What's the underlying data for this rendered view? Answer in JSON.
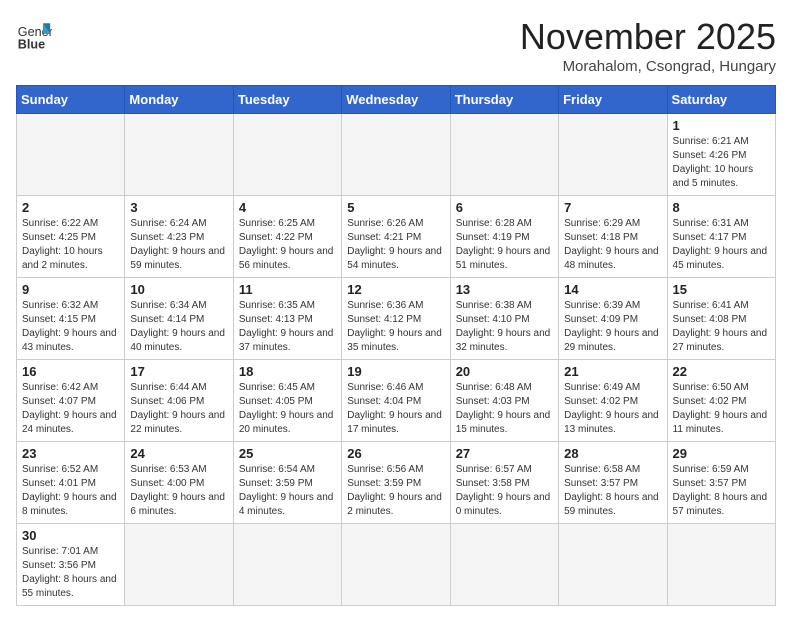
{
  "header": {
    "logo_text_normal": "General",
    "logo_text_bold": "Blue",
    "title": "November 2025",
    "subtitle": "Morahalom, Csongrad, Hungary"
  },
  "weekdays": [
    "Sunday",
    "Monday",
    "Tuesday",
    "Wednesday",
    "Thursday",
    "Friday",
    "Saturday"
  ],
  "weeks": [
    [
      {
        "day": "",
        "info": ""
      },
      {
        "day": "",
        "info": ""
      },
      {
        "day": "",
        "info": ""
      },
      {
        "day": "",
        "info": ""
      },
      {
        "day": "",
        "info": ""
      },
      {
        "day": "",
        "info": ""
      },
      {
        "day": "1",
        "info": "Sunrise: 6:21 AM\nSunset: 4:26 PM\nDaylight: 10 hours and 5 minutes."
      }
    ],
    [
      {
        "day": "2",
        "info": "Sunrise: 6:22 AM\nSunset: 4:25 PM\nDaylight: 10 hours and 2 minutes."
      },
      {
        "day": "3",
        "info": "Sunrise: 6:24 AM\nSunset: 4:23 PM\nDaylight: 9 hours and 59 minutes."
      },
      {
        "day": "4",
        "info": "Sunrise: 6:25 AM\nSunset: 4:22 PM\nDaylight: 9 hours and 56 minutes."
      },
      {
        "day": "5",
        "info": "Sunrise: 6:26 AM\nSunset: 4:21 PM\nDaylight: 9 hours and 54 minutes."
      },
      {
        "day": "6",
        "info": "Sunrise: 6:28 AM\nSunset: 4:19 PM\nDaylight: 9 hours and 51 minutes."
      },
      {
        "day": "7",
        "info": "Sunrise: 6:29 AM\nSunset: 4:18 PM\nDaylight: 9 hours and 48 minutes."
      },
      {
        "day": "8",
        "info": "Sunrise: 6:31 AM\nSunset: 4:17 PM\nDaylight: 9 hours and 45 minutes."
      }
    ],
    [
      {
        "day": "9",
        "info": "Sunrise: 6:32 AM\nSunset: 4:15 PM\nDaylight: 9 hours and 43 minutes."
      },
      {
        "day": "10",
        "info": "Sunrise: 6:34 AM\nSunset: 4:14 PM\nDaylight: 9 hours and 40 minutes."
      },
      {
        "day": "11",
        "info": "Sunrise: 6:35 AM\nSunset: 4:13 PM\nDaylight: 9 hours and 37 minutes."
      },
      {
        "day": "12",
        "info": "Sunrise: 6:36 AM\nSunset: 4:12 PM\nDaylight: 9 hours and 35 minutes."
      },
      {
        "day": "13",
        "info": "Sunrise: 6:38 AM\nSunset: 4:10 PM\nDaylight: 9 hours and 32 minutes."
      },
      {
        "day": "14",
        "info": "Sunrise: 6:39 AM\nSunset: 4:09 PM\nDaylight: 9 hours and 29 minutes."
      },
      {
        "day": "15",
        "info": "Sunrise: 6:41 AM\nSunset: 4:08 PM\nDaylight: 9 hours and 27 minutes."
      }
    ],
    [
      {
        "day": "16",
        "info": "Sunrise: 6:42 AM\nSunset: 4:07 PM\nDaylight: 9 hours and 24 minutes."
      },
      {
        "day": "17",
        "info": "Sunrise: 6:44 AM\nSunset: 4:06 PM\nDaylight: 9 hours and 22 minutes."
      },
      {
        "day": "18",
        "info": "Sunrise: 6:45 AM\nSunset: 4:05 PM\nDaylight: 9 hours and 20 minutes."
      },
      {
        "day": "19",
        "info": "Sunrise: 6:46 AM\nSunset: 4:04 PM\nDaylight: 9 hours and 17 minutes."
      },
      {
        "day": "20",
        "info": "Sunrise: 6:48 AM\nSunset: 4:03 PM\nDaylight: 9 hours and 15 minutes."
      },
      {
        "day": "21",
        "info": "Sunrise: 6:49 AM\nSunset: 4:02 PM\nDaylight: 9 hours and 13 minutes."
      },
      {
        "day": "22",
        "info": "Sunrise: 6:50 AM\nSunset: 4:02 PM\nDaylight: 9 hours and 11 minutes."
      }
    ],
    [
      {
        "day": "23",
        "info": "Sunrise: 6:52 AM\nSunset: 4:01 PM\nDaylight: 9 hours and 8 minutes."
      },
      {
        "day": "24",
        "info": "Sunrise: 6:53 AM\nSunset: 4:00 PM\nDaylight: 9 hours and 6 minutes."
      },
      {
        "day": "25",
        "info": "Sunrise: 6:54 AM\nSunset: 3:59 PM\nDaylight: 9 hours and 4 minutes."
      },
      {
        "day": "26",
        "info": "Sunrise: 6:56 AM\nSunset: 3:59 PM\nDaylight: 9 hours and 2 minutes."
      },
      {
        "day": "27",
        "info": "Sunrise: 6:57 AM\nSunset: 3:58 PM\nDaylight: 9 hours and 0 minutes."
      },
      {
        "day": "28",
        "info": "Sunrise: 6:58 AM\nSunset: 3:57 PM\nDaylight: 8 hours and 59 minutes."
      },
      {
        "day": "29",
        "info": "Sunrise: 6:59 AM\nSunset: 3:57 PM\nDaylight: 8 hours and 57 minutes."
      }
    ],
    [
      {
        "day": "30",
        "info": "Sunrise: 7:01 AM\nSunset: 3:56 PM\nDaylight: 8 hours and 55 minutes."
      },
      {
        "day": "",
        "info": ""
      },
      {
        "day": "",
        "info": ""
      },
      {
        "day": "",
        "info": ""
      },
      {
        "day": "",
        "info": ""
      },
      {
        "day": "",
        "info": ""
      },
      {
        "day": "",
        "info": ""
      }
    ]
  ]
}
